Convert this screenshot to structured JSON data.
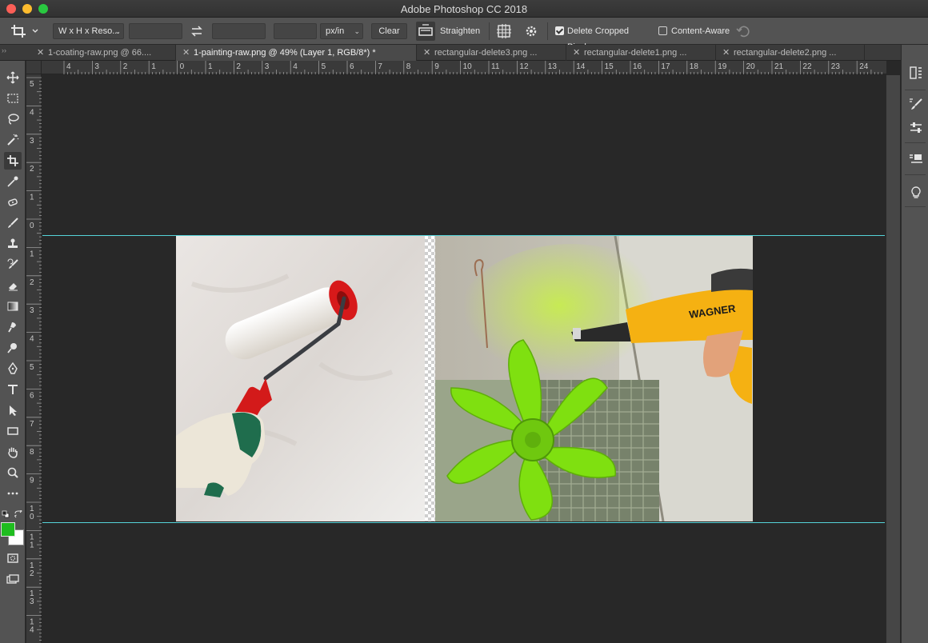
{
  "window": {
    "title": "Adobe Photoshop CC 2018"
  },
  "options_bar": {
    "ratio_select": "W x H x Reso...",
    "width_value": "",
    "height_value": "",
    "resolution_value": "",
    "unit_select": "px/in",
    "clear_label": "Clear",
    "straighten_label": "Straighten",
    "delete_cropped_label": "Delete Cropped Pixels",
    "delete_cropped_checked": true,
    "content_aware_label": "Content-Aware",
    "content_aware_checked": false
  },
  "tabs": [
    {
      "label": "1-coating-raw.png @ 66....",
      "active": false
    },
    {
      "label": "1-painting-raw.png @ 49% (Layer 1, RGB/8*) *",
      "active": true
    },
    {
      "label": "rectangular-delete3.png ...",
      "active": false
    },
    {
      "label": "rectangular-delete1.png ...",
      "active": false
    },
    {
      "label": "rectangular-delete2.png ...",
      "active": false
    }
  ],
  "tools": [
    "move-tool-icon",
    "marquee-tool-icon",
    "lasso-tool-icon",
    "magic-wand-tool-icon",
    "crop-tool-icon",
    "eyedropper-tool-icon",
    "healing-brush-tool-icon",
    "brush-tool-icon",
    "clone-stamp-tool-icon",
    "history-brush-tool-icon",
    "eraser-tool-icon",
    "gradient-tool-icon",
    "smudge-tool-icon",
    "dodge-tool-icon",
    "pen-tool-icon",
    "type-tool-icon",
    "path-selection-tool-icon",
    "rectangle-tool-icon",
    "hand-tool-icon",
    "zoom-tool-icon",
    "more-tools-icon"
  ],
  "colors": {
    "foreground": "#1fbd1f",
    "background": "#ffffff",
    "guide": "#55d3d9"
  },
  "rulers": {
    "horizontal_labels": [
      "4",
      "3",
      "2",
      "1",
      "0",
      "1",
      "2",
      "3",
      "4",
      "5",
      "6",
      "7",
      "8",
      "9",
      "10",
      "11",
      "12",
      "13",
      "14",
      "15",
      "16",
      "17",
      "18",
      "19",
      "20",
      "21",
      "22",
      "23",
      "24"
    ],
    "vertical_labels": [
      "5",
      "4",
      "3",
      "2",
      "1",
      "0",
      "1",
      "2",
      "3",
      "4",
      "5",
      "6",
      "7",
      "8",
      "9",
      "10",
      "11",
      "12",
      "13",
      "14"
    ]
  },
  "photo": {
    "brand_text": "WAGNER"
  }
}
